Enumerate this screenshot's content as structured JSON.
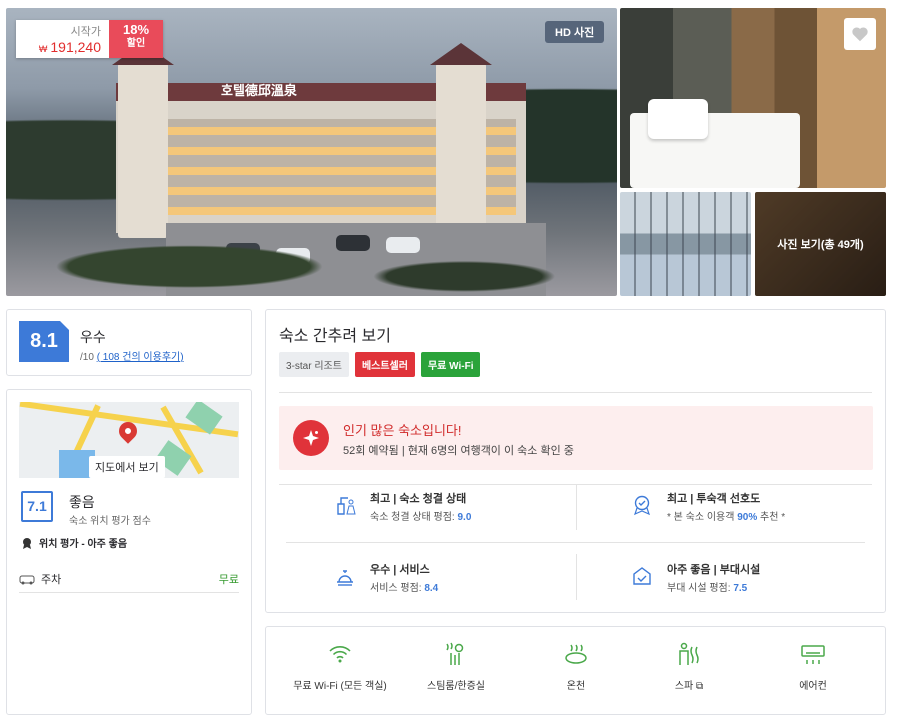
{
  "gallery": {
    "price_label": "시작가",
    "currency": "₩",
    "price": "191,240",
    "discount": "18%",
    "discount_word": "할인",
    "hd_label": "HD 사진",
    "more_photos": "사진 보기(총 49개)",
    "hotel_sign": "호텔德邱溫泉"
  },
  "review": {
    "score": "8.1",
    "word": "우수",
    "scale": "/10",
    "reviews_link": "( 108 건의 이용후기)"
  },
  "location": {
    "map_button": "지도에서 보기",
    "score": "7.1",
    "word": "좋음",
    "sub": "숙소 위치 평가 점수",
    "highlight": "위치 평가 - 아주 좋음",
    "parking_label": "주차",
    "parking_value": "무료"
  },
  "summary": {
    "title": "숙소 간추려 보기",
    "chips": [
      "3-star 리조트",
      "베스트셀러",
      "무료 Wi-Fi"
    ],
    "popular_title": "인기 많은 숙소입니다!",
    "popular_sub": "52회 예약됨 | 현재 6명의 여행객이 이 숙소 확인 중",
    "features": [
      {
        "title": "최고 | 숙소 청결 상태",
        "sub_prefix": "숙소 청결 상태 평점: ",
        "value": "9.0",
        "sub_suffix": "",
        "icon": "cleaning-icon"
      },
      {
        "title": "최고 | 투숙객 선호도",
        "sub_prefix": "* 본 숙소 이용객 ",
        "value": "90%",
        "sub_suffix": " 추천 *",
        "icon": "recommend-badge-icon"
      },
      {
        "title": "우수 | 서비스",
        "sub_prefix": "서비스 평점: ",
        "value": "8.4",
        "sub_suffix": "",
        "icon": "service-bell-icon"
      },
      {
        "title": "아주 좋음 | 부대시설",
        "sub_prefix": "부대 시설 평점: ",
        "value": "7.5",
        "sub_suffix": "",
        "icon": "facilities-icon"
      }
    ]
  },
  "facilities": [
    {
      "label": "무료 Wi-Fi (모든 객실)",
      "icon": "wifi-icon"
    },
    {
      "label": "스팀룸/한증실",
      "icon": "steam-room-icon"
    },
    {
      "label": "온천",
      "icon": "hot-spring-icon"
    },
    {
      "label": "스파 ⧉",
      "icon": "spa-icon"
    },
    {
      "label": "에어컨",
      "icon": "air-conditioner-icon"
    }
  ],
  "colors": {
    "accent": "#3d7ad8",
    "red": "#e0333a",
    "green": "#2aa33a",
    "facility_green": "#4aa84a"
  }
}
